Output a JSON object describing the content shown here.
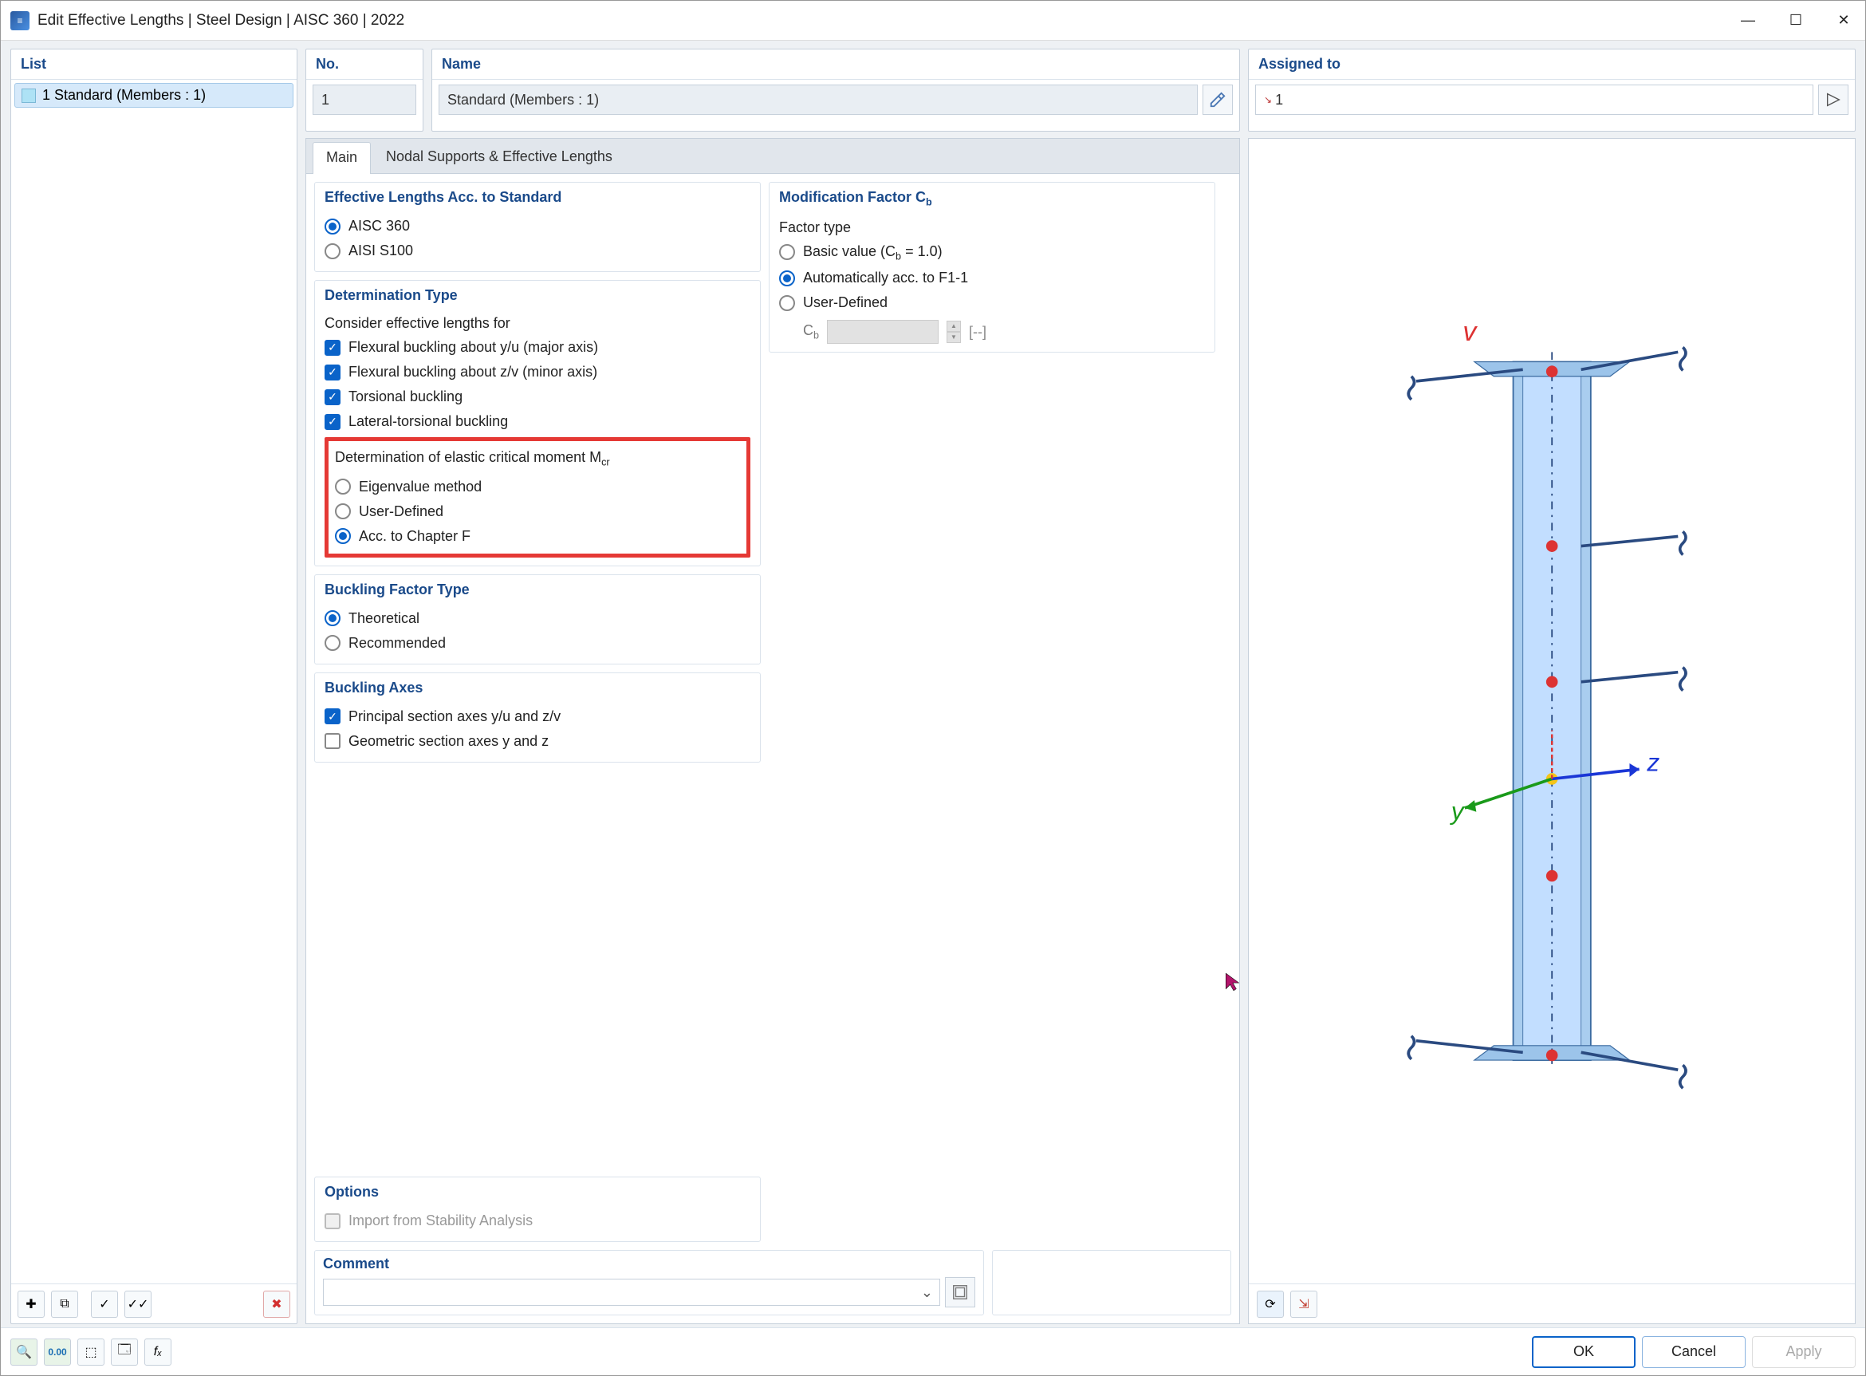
{
  "window": {
    "title": "Edit Effective Lengths | Steel Design | AISC 360 | 2022"
  },
  "list": {
    "header": "List",
    "item": "1 Standard (Members : 1)"
  },
  "no": {
    "header": "No.",
    "value": "1"
  },
  "name": {
    "header": "Name",
    "value": "Standard (Members : 1)"
  },
  "assigned": {
    "header": "Assigned to",
    "value": "1"
  },
  "tabs": {
    "main": "Main",
    "nodal": "Nodal Supports & Effective Lengths"
  },
  "groups": {
    "eff_std": {
      "header": "Effective Lengths Acc. to Standard",
      "aisc360": "AISC 360",
      "aisis100": "AISI S100"
    },
    "det_type": {
      "header": "Determination Type",
      "consider": "Consider effective lengths for",
      "flex_yu": "Flexural buckling about y/u (major axis)",
      "flex_zv": "Flexural buckling about z/v (minor axis)",
      "torsional": "Torsional buckling",
      "ltb": "Lateral-torsional buckling",
      "mcr_label": "Determination of elastic critical moment M",
      "mcr_sub": "cr",
      "eigen": "Eigenvalue method",
      "userdef": "User-Defined",
      "chapf": "Acc. to Chapter F"
    },
    "bf_type": {
      "header": "Buckling Factor Type",
      "theoretical": "Theoretical",
      "recommended": "Recommended"
    },
    "axes": {
      "header": "Buckling Axes",
      "principal": "Principal section axes y/u and z/v",
      "geometric": "Geometric section axes y and z"
    },
    "options": {
      "header": "Options",
      "import": "Import from Stability Analysis"
    },
    "mod_cb": {
      "header": "Modification Factor C",
      "sub": "b",
      "factor_type": "Factor type",
      "basic": "Basic value (C",
      "basic_sub": "b",
      "basic_tail": " = 1.0)",
      "auto": "Automatically acc. to F1-1",
      "userdef": "User-Defined",
      "cb_label": "C",
      "cb_sub": "b",
      "unit": "[--]"
    }
  },
  "comment": {
    "header": "Comment"
  },
  "preview": {
    "axis_v": "v",
    "axis_y": "y",
    "axis_z": "z"
  },
  "footer": {
    "ok": "OK",
    "cancel": "Cancel",
    "apply": "Apply"
  }
}
